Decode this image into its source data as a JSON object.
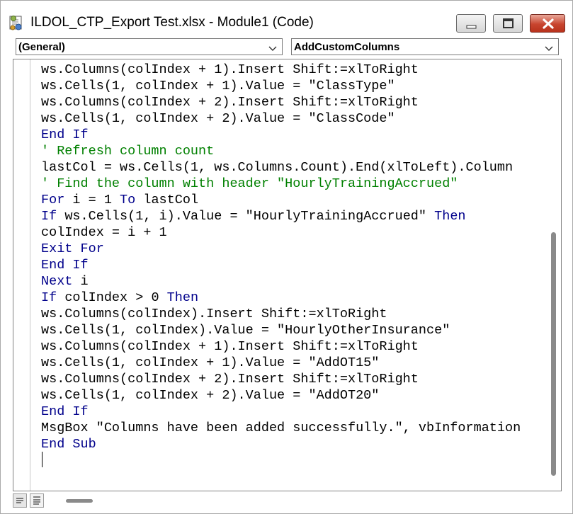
{
  "window": {
    "title": "ILDOL_CTP_Export Test.xlsx - Module1 (Code)"
  },
  "icons": {
    "app": "vba-module-icon",
    "minimize": "minimize-icon",
    "maximize": "maximize-icon",
    "close": "close-icon",
    "dropdown": "chevron-down-icon"
  },
  "combos": {
    "object": {
      "selected": "(General)"
    },
    "procedure": {
      "selected": "AddCustomColumns"
    }
  },
  "colors": {
    "keyword": "#00008b",
    "comment": "#008000",
    "text": "#000000",
    "close_button": "#c8452f"
  },
  "code_lines": [
    [
      [
        "t",
        "ws.Columns(colIndex + 1).Insert Shift:=xlToRight"
      ]
    ],
    [
      [
        "t",
        "ws.Cells(1, colIndex + 1).Value = \"ClassType\""
      ]
    ],
    [
      [
        "t",
        "ws.Columns(colIndex + 2).Insert Shift:=xlToRight"
      ]
    ],
    [
      [
        "t",
        "ws.Cells(1, colIndex + 2).Value = \"ClassCode\""
      ]
    ],
    [
      [
        "k",
        "End If"
      ]
    ],
    [
      [
        "c",
        "' Refresh column count"
      ]
    ],
    [
      [
        "t",
        "lastCol = ws.Cells(1, ws.Columns.Count).End(xlToLeft).Column"
      ]
    ],
    [
      [
        "c",
        "' Find the column with header \"HourlyTrainingAccrued\""
      ]
    ],
    [
      [
        "k",
        "For"
      ],
      [
        "t",
        " i = 1 "
      ],
      [
        "k",
        "To"
      ],
      [
        "t",
        " lastCol"
      ]
    ],
    [
      [
        "k",
        "If"
      ],
      [
        "t",
        " ws.Cells(1, i).Value = \"HourlyTrainingAccrued\" "
      ],
      [
        "k",
        "Then"
      ]
    ],
    [
      [
        "t",
        "colIndex = i + 1"
      ]
    ],
    [
      [
        "k",
        "Exit For"
      ]
    ],
    [
      [
        "k",
        "End If"
      ]
    ],
    [
      [
        "k",
        "Next"
      ],
      [
        "t",
        " i"
      ]
    ],
    [
      [
        "k",
        "If"
      ],
      [
        "t",
        " colIndex > 0 "
      ],
      [
        "k",
        "Then"
      ]
    ],
    [
      [
        "t",
        "ws.Columns(colIndex).Insert Shift:=xlToRight"
      ]
    ],
    [
      [
        "t",
        "ws.Cells(1, colIndex).Value = \"HourlyOtherInsurance\""
      ]
    ],
    [
      [
        "t",
        "ws.Columns(colIndex + 1).Insert Shift:=xlToRight"
      ]
    ],
    [
      [
        "t",
        "ws.Cells(1, colIndex + 1).Value = \"AddOT15\""
      ]
    ],
    [
      [
        "t",
        "ws.Columns(colIndex + 2).Insert Shift:=xlToRight"
      ]
    ],
    [
      [
        "t",
        "ws.Cells(1, colIndex + 2).Value = \"AddOT20\""
      ]
    ],
    [
      [
        "k",
        "End If"
      ]
    ],
    [
      [
        "t",
        "MsgBox \"Columns have been added successfully.\", vbInformation"
      ]
    ],
    [
      [
        "k",
        "End Sub"
      ]
    ]
  ]
}
